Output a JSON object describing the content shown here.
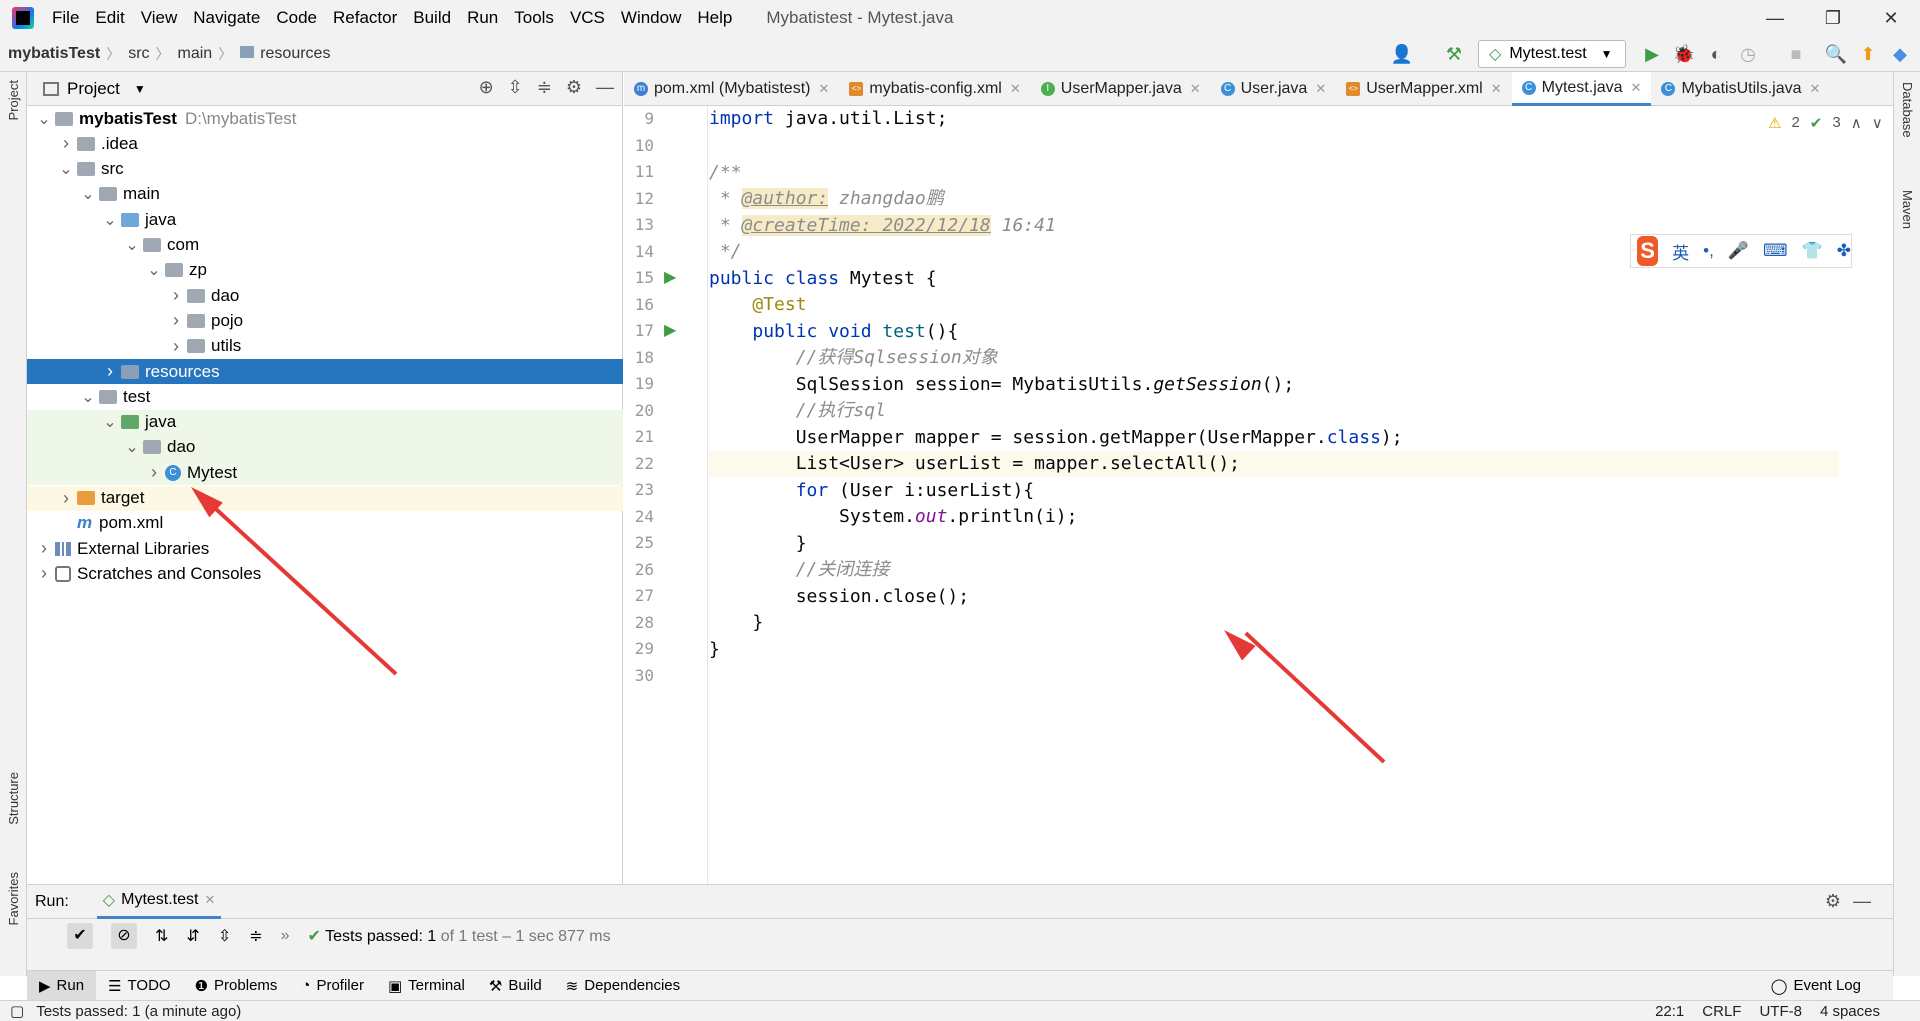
{
  "menubar": {
    "items": [
      "File",
      "Edit",
      "View",
      "Navigate",
      "Code",
      "Refactor",
      "Build",
      "Run",
      "Tools",
      "VCS",
      "Window",
      "Help"
    ],
    "window_title": "Mybatistest - Mytest.java"
  },
  "breadcrumb": [
    "mybatisTest",
    "src",
    "main",
    "resources"
  ],
  "toolbar": {
    "run_config": "Mytest.test"
  },
  "left_strip": {
    "project": "Project",
    "structure": "Structure",
    "favorites": "Favorites"
  },
  "right_strip": {
    "database": "Database",
    "maven": "Maven"
  },
  "project_panel": {
    "title": "Project",
    "tree": [
      {
        "label": "mybatisTest",
        "path": "D:\\mybatisTest",
        "depth": 0,
        "icon": "folder",
        "expanded": true,
        "bold": true
      },
      {
        "label": ".idea",
        "depth": 1,
        "icon": "folder",
        "expanded": false
      },
      {
        "label": "src",
        "depth": 1,
        "icon": "folder",
        "expanded": true
      },
      {
        "label": "main",
        "depth": 2,
        "icon": "folder",
        "expanded": true
      },
      {
        "label": "java",
        "depth": 3,
        "icon": "folder-blue",
        "expanded": true
      },
      {
        "label": "com",
        "depth": 4,
        "icon": "package",
        "expanded": true
      },
      {
        "label": "zp",
        "depth": 5,
        "icon": "package",
        "expanded": true
      },
      {
        "label": "dao",
        "depth": 6,
        "icon": "package",
        "expanded": false
      },
      {
        "label": "pojo",
        "depth": 6,
        "icon": "package",
        "expanded": false
      },
      {
        "label": "utils",
        "depth": 6,
        "icon": "package",
        "expanded": false
      },
      {
        "label": "resources",
        "depth": 3,
        "icon": "folder-res",
        "expanded": false,
        "selected": true
      },
      {
        "label": "test",
        "depth": 2,
        "icon": "folder",
        "expanded": true
      },
      {
        "label": "java",
        "depth": 3,
        "icon": "folder-green",
        "expanded": true,
        "testbg": true
      },
      {
        "label": "dao",
        "depth": 4,
        "icon": "package",
        "expanded": true,
        "testbg": true
      },
      {
        "label": "Mytest",
        "depth": 5,
        "icon": "class",
        "expanded": false,
        "testbg": true
      },
      {
        "label": "target",
        "depth": 1,
        "icon": "folder-orange",
        "expanded": false,
        "excluded": true
      },
      {
        "label": "pom.xml",
        "depth": 1,
        "icon": "maven",
        "leaf": true
      },
      {
        "label": "External Libraries",
        "depth": 0,
        "icon": "library",
        "expanded": false
      },
      {
        "label": "Scratches and Consoles",
        "depth": 0,
        "icon": "scratch",
        "expanded": false
      }
    ]
  },
  "editor": {
    "tabs": [
      {
        "label": "pom.xml (Mybatistest)",
        "icon": "maven"
      },
      {
        "label": "mybatis-config.xml",
        "icon": "xml"
      },
      {
        "label": "UserMapper.java",
        "icon": "interface"
      },
      {
        "label": "User.java",
        "icon": "class"
      },
      {
        "label": "UserMapper.xml",
        "icon": "xml"
      },
      {
        "label": "Mytest.java",
        "icon": "class",
        "active": true
      },
      {
        "label": "MybatisUtils.java",
        "icon": "class"
      }
    ],
    "inspections": {
      "warnings": "2",
      "weak_warnings": "3"
    },
    "line_numbers": [
      "9",
      "10",
      "11",
      "12",
      "13",
      "14",
      "15",
      "16",
      "17",
      "18",
      "19",
      "20",
      "21",
      "22",
      "23",
      "24",
      "25",
      "26",
      "27",
      "28",
      "29",
      "30"
    ],
    "current_line": "22"
  },
  "ime_bar": {
    "lang": "英",
    "punct": "•,"
  },
  "run_panel": {
    "label": "Run:",
    "tab": "Mytest.test",
    "status_prefix": "Tests passed:",
    "status_count": "1",
    "status_rest": "of 1 test – 1 sec 877 ms"
  },
  "tool_windows": [
    "Run",
    "TODO",
    "Problems",
    "Profiler",
    "Terminal",
    "Build",
    "Dependencies"
  ],
  "event_log": "Event Log",
  "status_bar": {
    "message": "Tests passed: 1 (a minute ago)",
    "position": "22:1",
    "line_sep": "CRLF",
    "encoding": "UTF-8",
    "indent": "4 spaces"
  },
  "colors": {
    "selection": "#2675bf",
    "accent": "#4083c9",
    "test_bg": "#eef7e8",
    "excluded_bg": "#fcf8e3",
    "arrow": "#e53935"
  }
}
